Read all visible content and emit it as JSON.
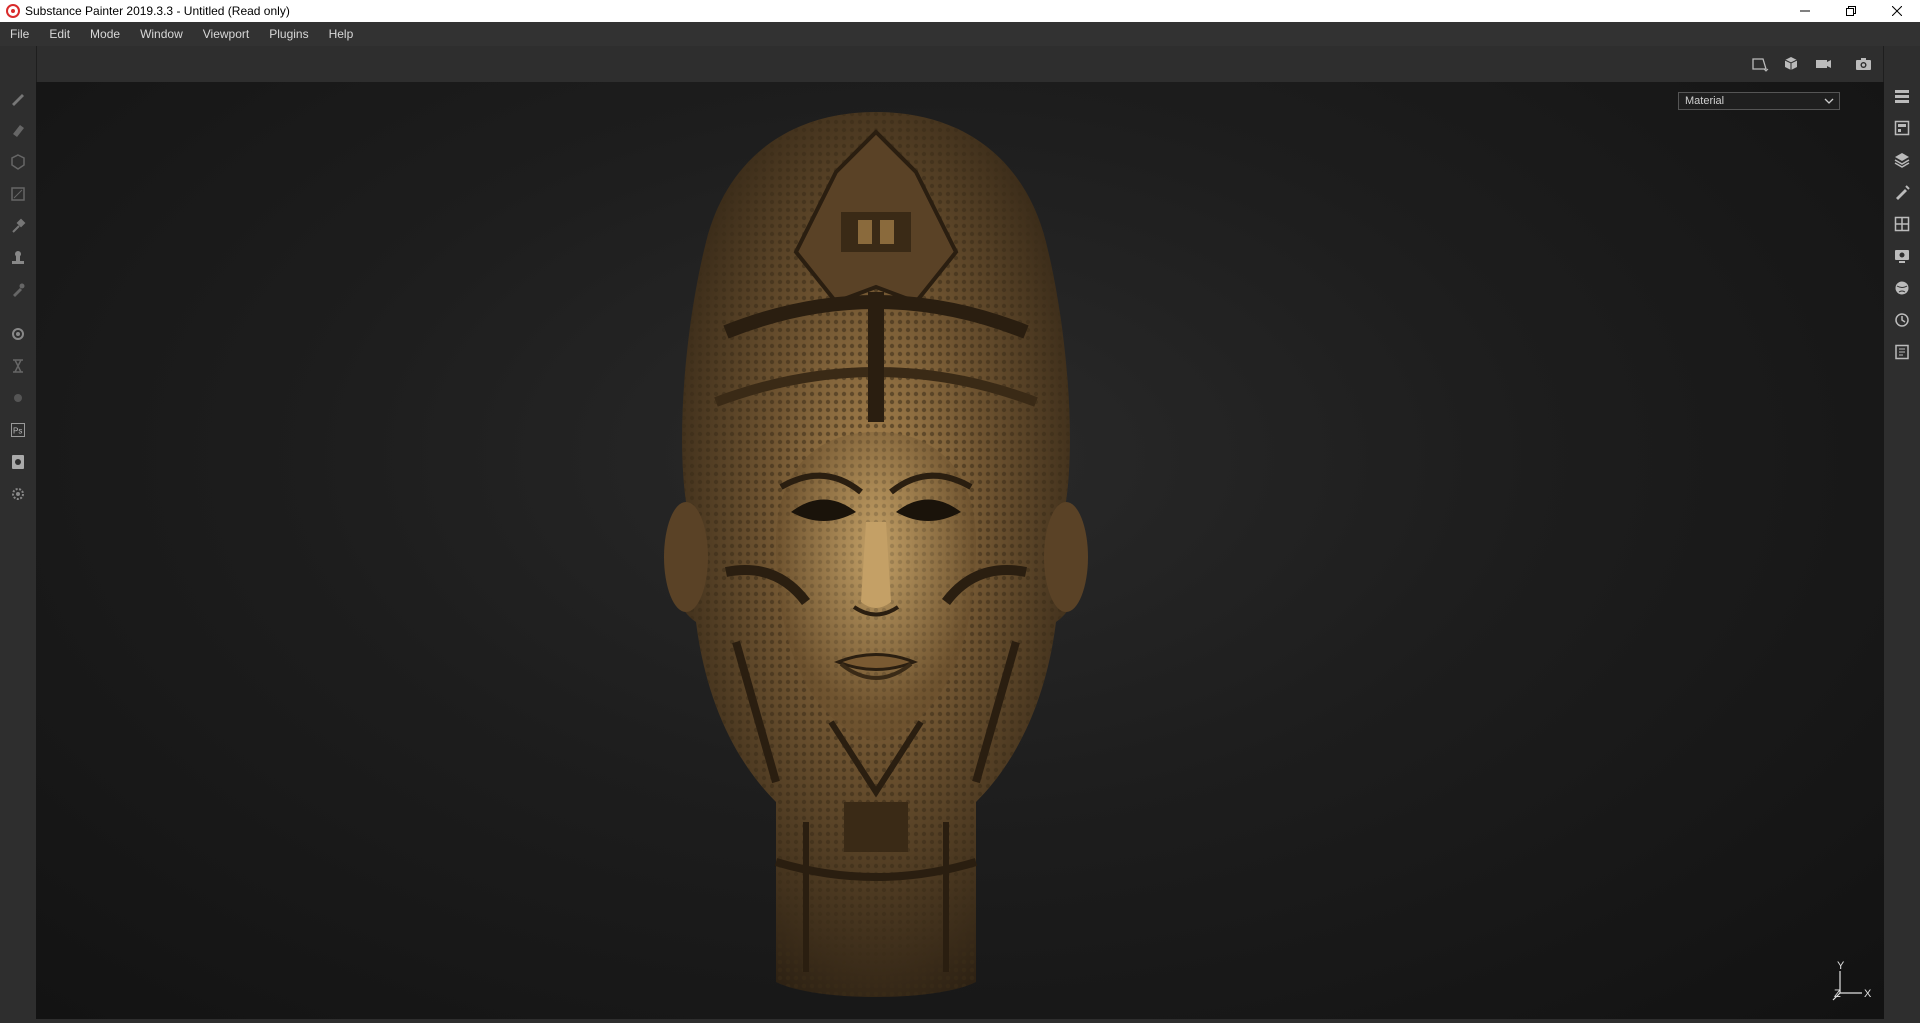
{
  "window": {
    "title": "Substance Painter 2019.3.3 - Untitled (Read only)",
    "controls": [
      "minimize-icon",
      "restore-icon",
      "close-icon"
    ]
  },
  "menubar": {
    "items": [
      "File",
      "Edit",
      "Mode",
      "Window",
      "Viewport",
      "Plugins",
      "Help"
    ]
  },
  "top_toolbar": {
    "icons": [
      "viewport-frame-icon",
      "cube-view-icon",
      "camera-icon",
      "screenshot-icon"
    ]
  },
  "left_shelf": {
    "icons": [
      "paint-brush-icon",
      "eraser-icon",
      "projection-icon",
      "polygon-fill-icon",
      "smudge-icon",
      "clone-stamp-icon",
      "color-picker-icon",
      "bake-settings-icon",
      "measure-icon",
      "material-icon",
      "photoshop-icon",
      "export-icon",
      "settings-icon"
    ]
  },
  "right_shelf": {
    "icons": [
      "layers-stack-icon",
      "texture-set-icon",
      "layers-icon",
      "brush-properties-icon",
      "uv-grid-icon",
      "display-settings-icon",
      "environment-icon",
      "history-icon",
      "log-icon"
    ]
  },
  "viewport": {
    "mode_select": "Material",
    "axis": {
      "x": "X",
      "y": "Y",
      "z": "Z"
    }
  },
  "colors": {
    "background": "#2b2b2b",
    "viewport_center": "#2a2a2a",
    "bronze": "#8a6a3c"
  }
}
